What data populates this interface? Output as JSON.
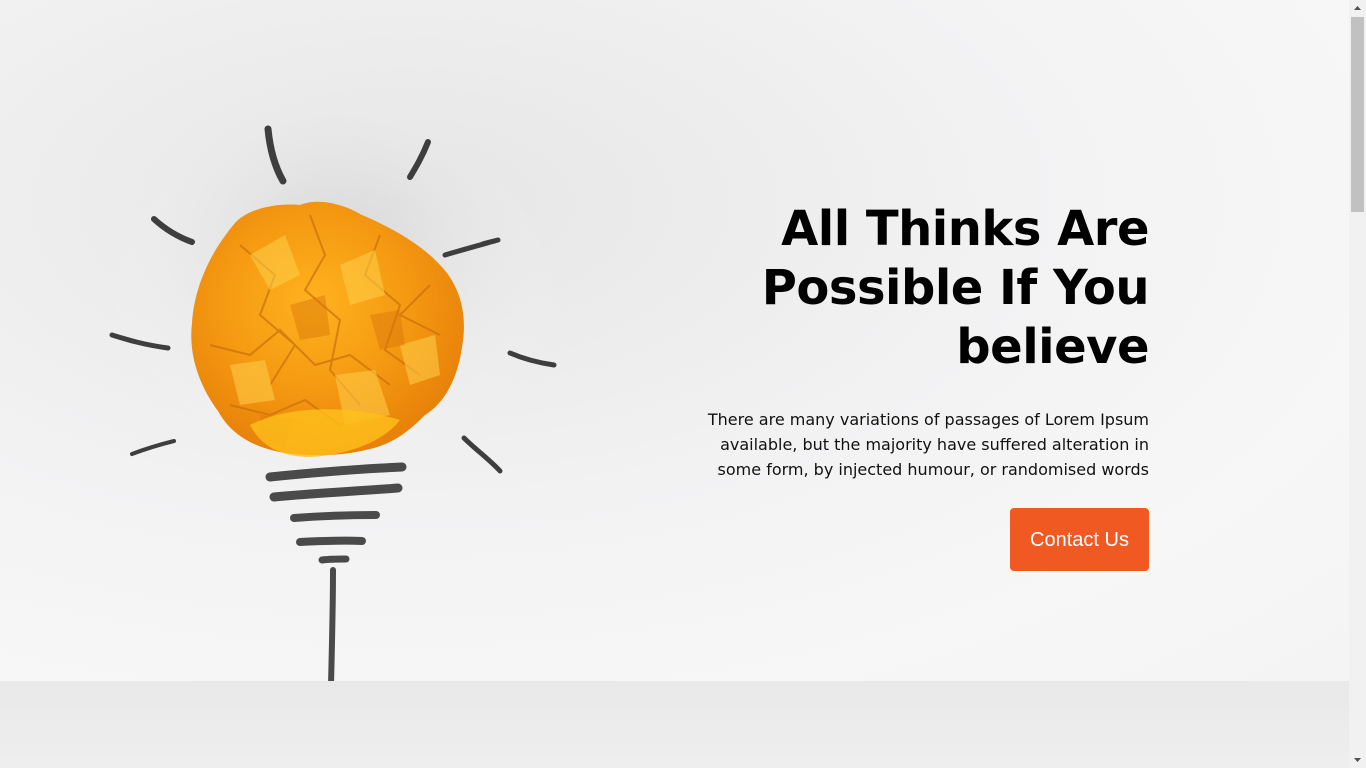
{
  "hero": {
    "title": "All Thinks Are Possible If You believe",
    "description": "There are many variations of passages of Lorem Ipsum available, but the majority have suffered alteration in some form, by injected humour, or randomised words",
    "cta_label": "Contact Us"
  },
  "colors": {
    "accent": "#f05a22",
    "bulb_orange": "#f6a21a",
    "sketch": "#4a4a4a"
  },
  "icons": {
    "illustration": "crumpled-paper-lightbulb"
  }
}
